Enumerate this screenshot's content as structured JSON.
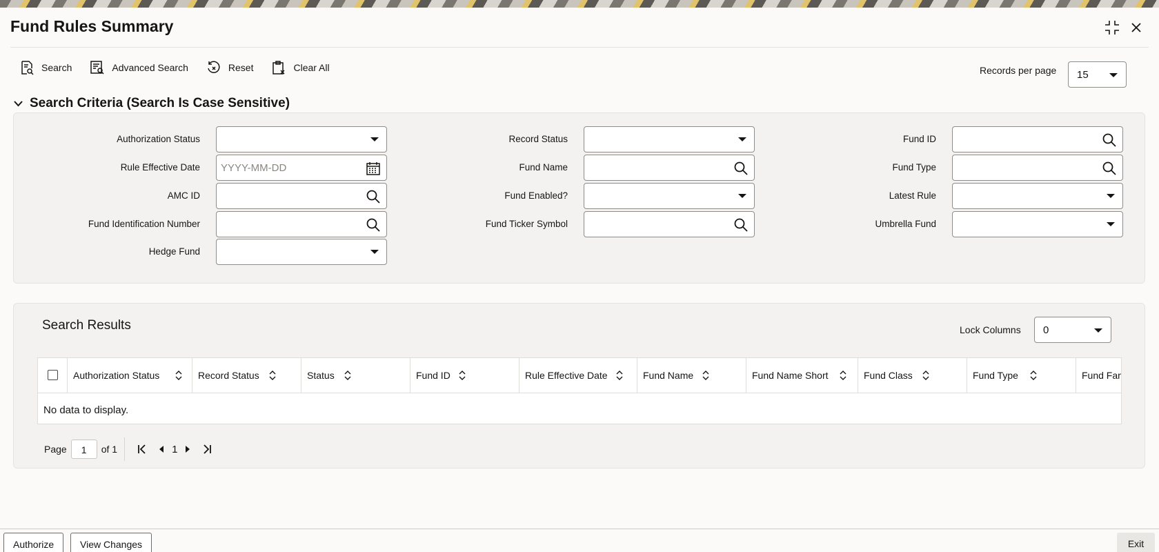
{
  "window": {
    "title": "Fund Rules Summary",
    "icons": [
      "collapse-icon",
      "close-icon"
    ]
  },
  "toolbar": {
    "search_label": "Search",
    "advanced_search_label": "Advanced Search",
    "reset_label": "Reset",
    "clear_all_label": "Clear All",
    "records_per_page_label": "Records per page",
    "records_per_page_value": "15"
  },
  "criteria": {
    "title": "Search Criteria (Search Is Case Sensitive)",
    "fields": {
      "authorization_status": {
        "label": "Authorization Status",
        "value": ""
      },
      "rule_effective_date": {
        "label": "Rule Effective Date",
        "placeholder": "YYYY-MM-DD"
      },
      "amc_id": {
        "label": "AMC ID",
        "value": ""
      },
      "fund_identification_number": {
        "label": "Fund Identification Number",
        "value": ""
      },
      "hedge_fund": {
        "label": "Hedge Fund",
        "value": ""
      },
      "record_status": {
        "label": "Record Status",
        "value": ""
      },
      "fund_name": {
        "label": "Fund Name",
        "value": ""
      },
      "fund_enabled": {
        "label": "Fund Enabled?",
        "value": ""
      },
      "fund_ticker_symbol": {
        "label": "Fund Ticker Symbol",
        "value": ""
      },
      "fund_id": {
        "label": "Fund ID",
        "value": ""
      },
      "fund_type": {
        "label": "Fund Type",
        "value": ""
      },
      "latest_rule": {
        "label": "Latest Rule",
        "value": ""
      },
      "umbrella_fund": {
        "label": "Umbrella Fund",
        "value": ""
      }
    }
  },
  "results": {
    "title": "Search Results",
    "lock_columns_label": "Lock Columns",
    "lock_columns_value": "0",
    "columns": [
      "Authorization Status",
      "Record Status",
      "Status",
      "Fund ID",
      "Rule Effective Date",
      "Fund Name",
      "Fund Name Short",
      "Fund Class",
      "Fund Type",
      "Fund Fan"
    ],
    "empty_message": "No data to display.",
    "pager": {
      "page_label": "Page",
      "page_value": "1",
      "of_label": "of 1",
      "current_page": "1"
    }
  },
  "footer": {
    "authorize_label": "Authorize",
    "view_changes_label": "View Changes",
    "exit_label": "Exit"
  }
}
